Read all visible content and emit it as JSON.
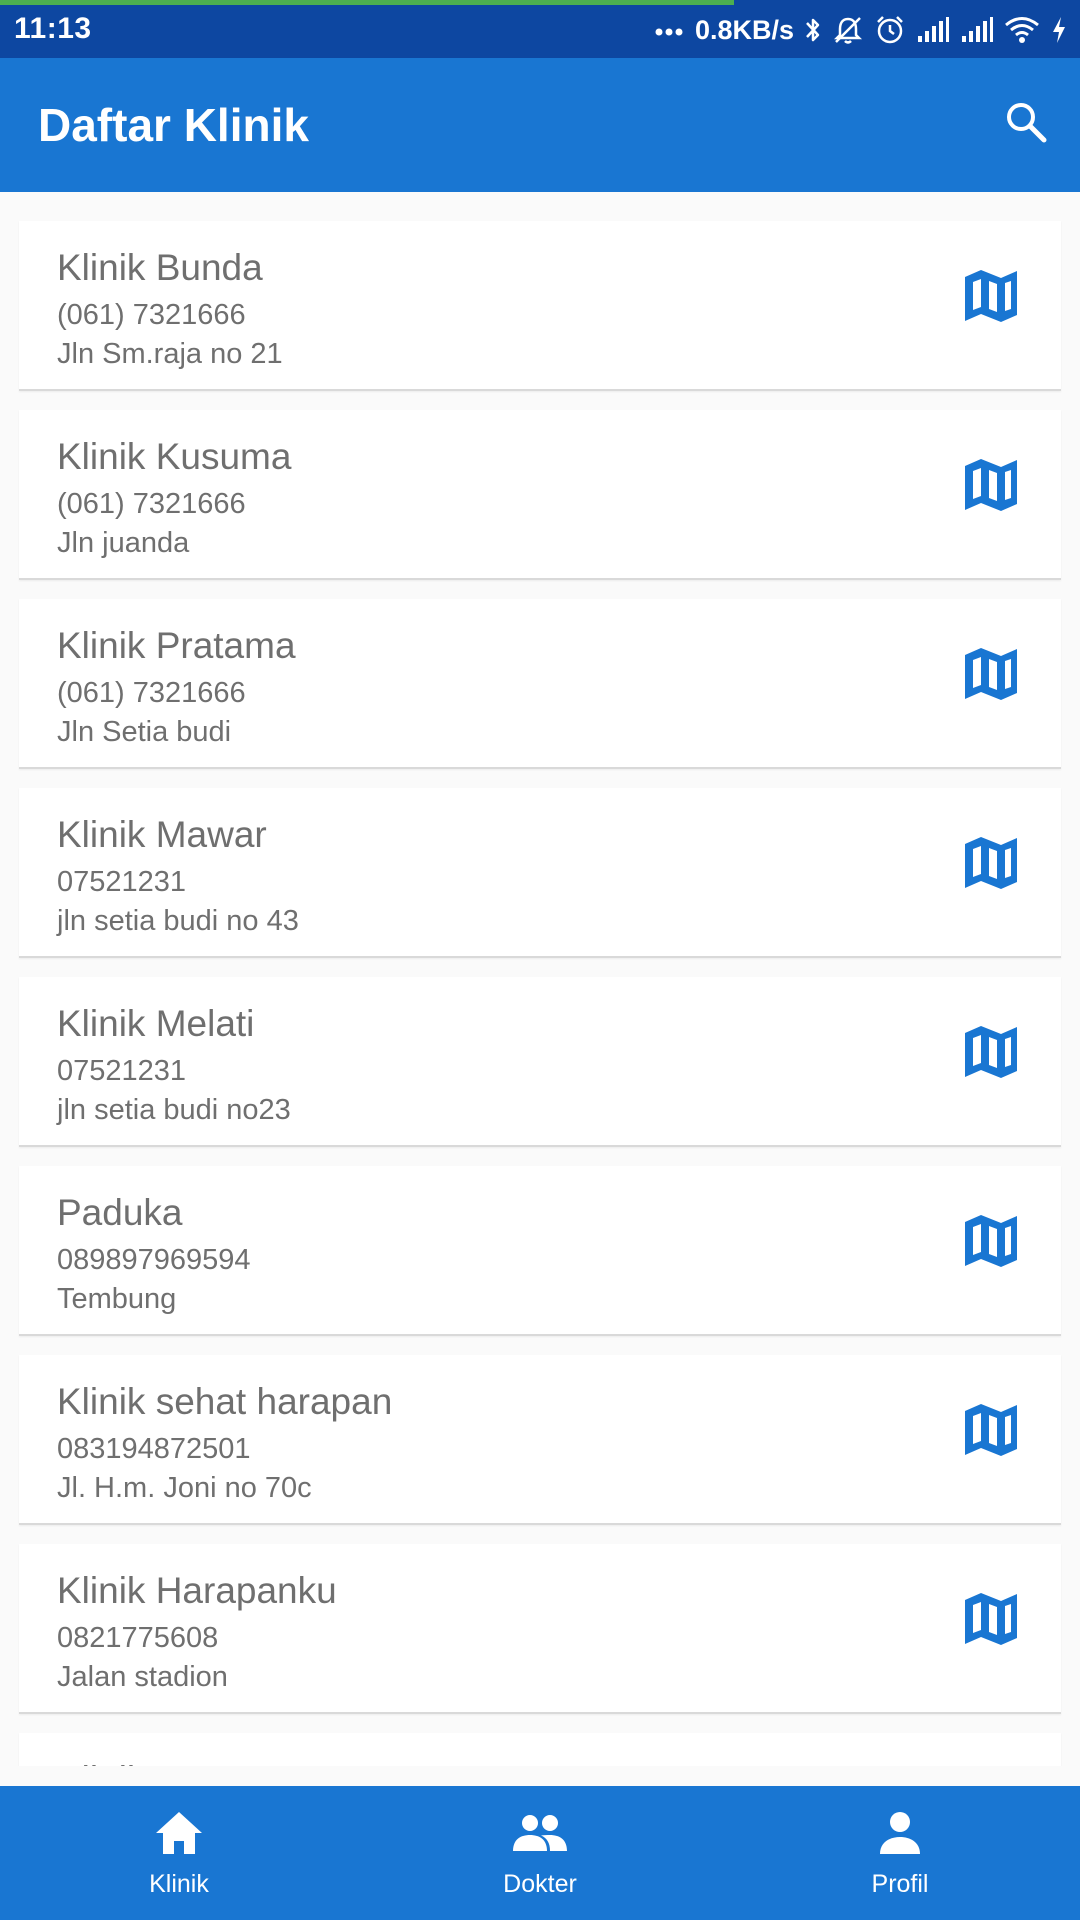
{
  "colors": {
    "status_bar": "#0d47a1",
    "primary": "#1976d2",
    "progress": "#4caf50",
    "text_secondary": "#6f6f6f",
    "background": "#fafafa"
  },
  "status_bar": {
    "time": "11:13",
    "network_speed": "0.8KB/s",
    "load_progress_percent": 68,
    "icons": [
      "more-dots-icon",
      "bluetooth-icon",
      "notifications-off-icon",
      "alarm-icon",
      "signal-icon",
      "signal-icon",
      "wifi-icon",
      "charging-icon"
    ]
  },
  "app_bar": {
    "title": "Daftar Klinik",
    "search_icon": "search-icon"
  },
  "clinics": [
    {
      "name": "Klinik Bunda",
      "phone": "(061) 7321666",
      "address": "Jln Sm.raja no 21"
    },
    {
      "name": "Klinik Kusuma",
      "phone": "(061) 7321666",
      "address": "Jln juanda"
    },
    {
      "name": "Klinik Pratama",
      "phone": "(061) 7321666",
      "address": "Jln Setia budi"
    },
    {
      "name": "Klinik Mawar",
      "phone": "07521231",
      "address": "jln setia budi no 43"
    },
    {
      "name": "Klinik Melati",
      "phone": "07521231",
      "address": "jln setia budi no23"
    },
    {
      "name": "Paduka",
      "phone": "089897969594",
      "address": "Tembung"
    },
    {
      "name": "Klinik sehat harapan",
      "phone": "083194872501",
      "address": "Jl. H.m. Joni no 70c"
    },
    {
      "name": "Klinik Harapanku",
      "phone": "0821775608",
      "address": "Jalan stadion"
    },
    {
      "name": "Klinik B",
      "phone": "",
      "address": ""
    }
  ],
  "clinic_action_icon": "map-icon",
  "bottom_nav": {
    "items": [
      {
        "label": "Klinik",
        "icon": "home-icon"
      },
      {
        "label": "Dokter",
        "icon": "people-icon"
      },
      {
        "label": "Profil",
        "icon": "person-icon"
      }
    ]
  }
}
